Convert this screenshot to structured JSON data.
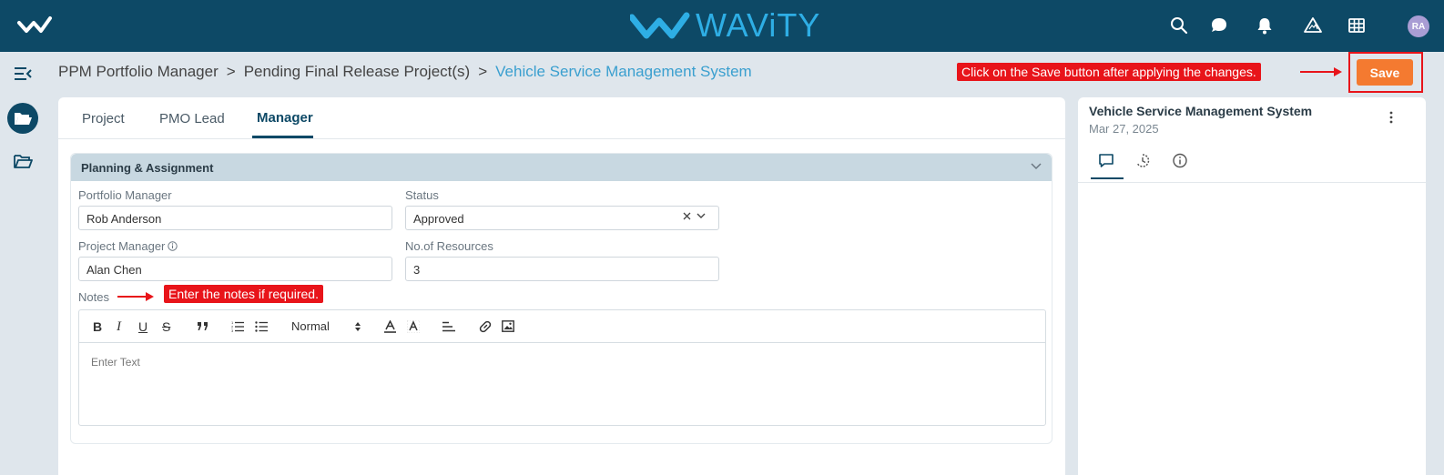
{
  "app": {
    "brand_name": "WAViTY",
    "user_initials": "RA",
    "colors": {
      "header": "#0d4966",
      "accent": "#3a9fcf",
      "save": "#f47a30",
      "annotation": "#e8141a"
    }
  },
  "header_icons": [
    "search-icon",
    "chat-icon",
    "bell-icon",
    "triangle-icon",
    "grid-icon"
  ],
  "breadcrumb": {
    "items": [
      "PPM Portfolio Manager",
      "Pending Final Release Project(s)"
    ],
    "separator": ">",
    "current": "Vehicle Service Management System"
  },
  "annotations": {
    "save": "Click on the Save button after applying the changes.",
    "notes": "Enter the notes if required."
  },
  "toolbar": {
    "save_label": "Save"
  },
  "tabs": [
    "Project",
    "PMO Lead",
    "Manager"
  ],
  "active_tab": "Manager",
  "section": {
    "title": "Planning & Assignment",
    "fields": {
      "portfolio_manager": {
        "label": "Portfolio Manager",
        "value": "Rob Anderson"
      },
      "status": {
        "label": "Status",
        "value": "Approved"
      },
      "project_manager": {
        "label": "Project Manager",
        "value": "Alan Chen"
      },
      "resources": {
        "label": "No.of Resources",
        "value": "3"
      }
    },
    "notes": {
      "label": "Notes",
      "font_select": "Normal",
      "placeholder": "Enter Text"
    }
  },
  "side_panel": {
    "title": "Vehicle Service Management System",
    "date": "Mar 27, 2025",
    "tabs": [
      "comment-icon",
      "history-icon",
      "info-icon"
    ]
  }
}
